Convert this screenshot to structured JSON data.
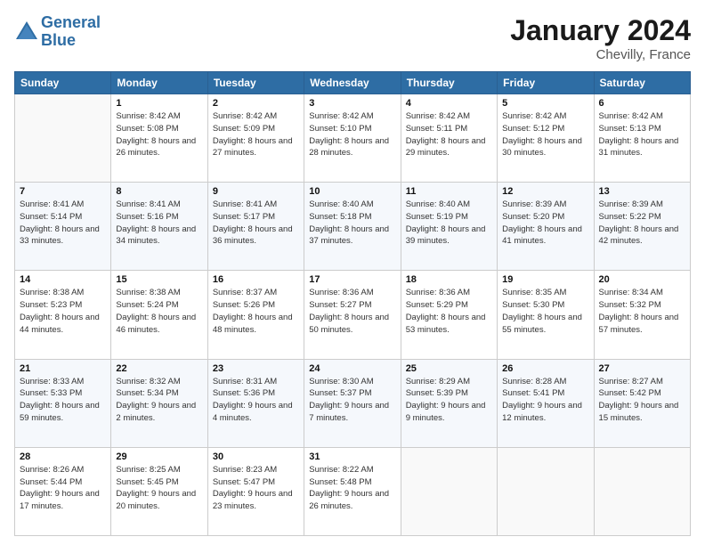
{
  "header": {
    "logo_line1": "General",
    "logo_line2": "Blue",
    "month_title": "January 2024",
    "location": "Chevilly, France"
  },
  "columns": [
    "Sunday",
    "Monday",
    "Tuesday",
    "Wednesday",
    "Thursday",
    "Friday",
    "Saturday"
  ],
  "weeks": [
    [
      {
        "day": "",
        "sunrise": "",
        "sunset": "",
        "daylight": ""
      },
      {
        "day": "1",
        "sunrise": "Sunrise: 8:42 AM",
        "sunset": "Sunset: 5:08 PM",
        "daylight": "Daylight: 8 hours and 26 minutes."
      },
      {
        "day": "2",
        "sunrise": "Sunrise: 8:42 AM",
        "sunset": "Sunset: 5:09 PM",
        "daylight": "Daylight: 8 hours and 27 minutes."
      },
      {
        "day": "3",
        "sunrise": "Sunrise: 8:42 AM",
        "sunset": "Sunset: 5:10 PM",
        "daylight": "Daylight: 8 hours and 28 minutes."
      },
      {
        "day": "4",
        "sunrise": "Sunrise: 8:42 AM",
        "sunset": "Sunset: 5:11 PM",
        "daylight": "Daylight: 8 hours and 29 minutes."
      },
      {
        "day": "5",
        "sunrise": "Sunrise: 8:42 AM",
        "sunset": "Sunset: 5:12 PM",
        "daylight": "Daylight: 8 hours and 30 minutes."
      },
      {
        "day": "6",
        "sunrise": "Sunrise: 8:42 AM",
        "sunset": "Sunset: 5:13 PM",
        "daylight": "Daylight: 8 hours and 31 minutes."
      }
    ],
    [
      {
        "day": "7",
        "sunrise": "Sunrise: 8:41 AM",
        "sunset": "Sunset: 5:14 PM",
        "daylight": "Daylight: 8 hours and 33 minutes."
      },
      {
        "day": "8",
        "sunrise": "Sunrise: 8:41 AM",
        "sunset": "Sunset: 5:16 PM",
        "daylight": "Daylight: 8 hours and 34 minutes."
      },
      {
        "day": "9",
        "sunrise": "Sunrise: 8:41 AM",
        "sunset": "Sunset: 5:17 PM",
        "daylight": "Daylight: 8 hours and 36 minutes."
      },
      {
        "day": "10",
        "sunrise": "Sunrise: 8:40 AM",
        "sunset": "Sunset: 5:18 PM",
        "daylight": "Daylight: 8 hours and 37 minutes."
      },
      {
        "day": "11",
        "sunrise": "Sunrise: 8:40 AM",
        "sunset": "Sunset: 5:19 PM",
        "daylight": "Daylight: 8 hours and 39 minutes."
      },
      {
        "day": "12",
        "sunrise": "Sunrise: 8:39 AM",
        "sunset": "Sunset: 5:20 PM",
        "daylight": "Daylight: 8 hours and 41 minutes."
      },
      {
        "day": "13",
        "sunrise": "Sunrise: 8:39 AM",
        "sunset": "Sunset: 5:22 PM",
        "daylight": "Daylight: 8 hours and 42 minutes."
      }
    ],
    [
      {
        "day": "14",
        "sunrise": "Sunrise: 8:38 AM",
        "sunset": "Sunset: 5:23 PM",
        "daylight": "Daylight: 8 hours and 44 minutes."
      },
      {
        "day": "15",
        "sunrise": "Sunrise: 8:38 AM",
        "sunset": "Sunset: 5:24 PM",
        "daylight": "Daylight: 8 hours and 46 minutes."
      },
      {
        "day": "16",
        "sunrise": "Sunrise: 8:37 AM",
        "sunset": "Sunset: 5:26 PM",
        "daylight": "Daylight: 8 hours and 48 minutes."
      },
      {
        "day": "17",
        "sunrise": "Sunrise: 8:36 AM",
        "sunset": "Sunset: 5:27 PM",
        "daylight": "Daylight: 8 hours and 50 minutes."
      },
      {
        "day": "18",
        "sunrise": "Sunrise: 8:36 AM",
        "sunset": "Sunset: 5:29 PM",
        "daylight": "Daylight: 8 hours and 53 minutes."
      },
      {
        "day": "19",
        "sunrise": "Sunrise: 8:35 AM",
        "sunset": "Sunset: 5:30 PM",
        "daylight": "Daylight: 8 hours and 55 minutes."
      },
      {
        "day": "20",
        "sunrise": "Sunrise: 8:34 AM",
        "sunset": "Sunset: 5:32 PM",
        "daylight": "Daylight: 8 hours and 57 minutes."
      }
    ],
    [
      {
        "day": "21",
        "sunrise": "Sunrise: 8:33 AM",
        "sunset": "Sunset: 5:33 PM",
        "daylight": "Daylight: 8 hours and 59 minutes."
      },
      {
        "day": "22",
        "sunrise": "Sunrise: 8:32 AM",
        "sunset": "Sunset: 5:34 PM",
        "daylight": "Daylight: 9 hours and 2 minutes."
      },
      {
        "day": "23",
        "sunrise": "Sunrise: 8:31 AM",
        "sunset": "Sunset: 5:36 PM",
        "daylight": "Daylight: 9 hours and 4 minutes."
      },
      {
        "day": "24",
        "sunrise": "Sunrise: 8:30 AM",
        "sunset": "Sunset: 5:37 PM",
        "daylight": "Daylight: 9 hours and 7 minutes."
      },
      {
        "day": "25",
        "sunrise": "Sunrise: 8:29 AM",
        "sunset": "Sunset: 5:39 PM",
        "daylight": "Daylight: 9 hours and 9 minutes."
      },
      {
        "day": "26",
        "sunrise": "Sunrise: 8:28 AM",
        "sunset": "Sunset: 5:41 PM",
        "daylight": "Daylight: 9 hours and 12 minutes."
      },
      {
        "day": "27",
        "sunrise": "Sunrise: 8:27 AM",
        "sunset": "Sunset: 5:42 PM",
        "daylight": "Daylight: 9 hours and 15 minutes."
      }
    ],
    [
      {
        "day": "28",
        "sunrise": "Sunrise: 8:26 AM",
        "sunset": "Sunset: 5:44 PM",
        "daylight": "Daylight: 9 hours and 17 minutes."
      },
      {
        "day": "29",
        "sunrise": "Sunrise: 8:25 AM",
        "sunset": "Sunset: 5:45 PM",
        "daylight": "Daylight: 9 hours and 20 minutes."
      },
      {
        "day": "30",
        "sunrise": "Sunrise: 8:23 AM",
        "sunset": "Sunset: 5:47 PM",
        "daylight": "Daylight: 9 hours and 23 minutes."
      },
      {
        "day": "31",
        "sunrise": "Sunrise: 8:22 AM",
        "sunset": "Sunset: 5:48 PM",
        "daylight": "Daylight: 9 hours and 26 minutes."
      },
      {
        "day": "",
        "sunrise": "",
        "sunset": "",
        "daylight": ""
      },
      {
        "day": "",
        "sunrise": "",
        "sunset": "",
        "daylight": ""
      },
      {
        "day": "",
        "sunrise": "",
        "sunset": "",
        "daylight": ""
      }
    ]
  ]
}
